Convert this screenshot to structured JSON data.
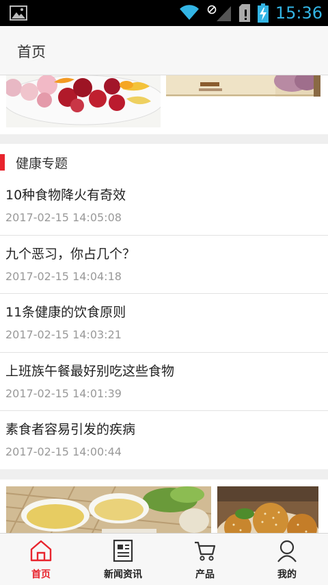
{
  "status_bar": {
    "time": "15:36",
    "icons": [
      "gallery-icon",
      "wifi-icon",
      "no-signal-icon",
      "cell-signal-icon",
      "sim-alert-icon",
      "battery-charging-icon"
    ],
    "accent_color": "#33b5e5"
  },
  "header": {
    "title": "首页"
  },
  "section": {
    "label": "健康专题",
    "accent_color": "#e8242d",
    "items": [
      {
        "title": "10种食物降火有奇效",
        "time": "2017-02-15 14:05:08"
      },
      {
        "title": "九个恶习，你占几个？",
        "time": "2017-02-15 14:04:18"
      },
      {
        "title": "11条健康的饮食原则",
        "time": "2017-02-15 14:03:21"
      },
      {
        "title": "上班族午餐最好别吃这些食物",
        "time": "2017-02-15 14:01:39"
      },
      {
        "title": "素食者容易引发的疾病",
        "time": "2017-02-15 14:00:44"
      }
    ]
  },
  "tabbar": {
    "active_color": "#e8242d",
    "tabs": [
      {
        "label": "首页",
        "icon": "home-icon",
        "active": true
      },
      {
        "label": "新闻资讯",
        "icon": "newspaper-icon",
        "active": false
      },
      {
        "label": "产品",
        "icon": "cart-icon",
        "active": false
      },
      {
        "label": "我的",
        "icon": "user-icon",
        "active": false
      }
    ]
  }
}
